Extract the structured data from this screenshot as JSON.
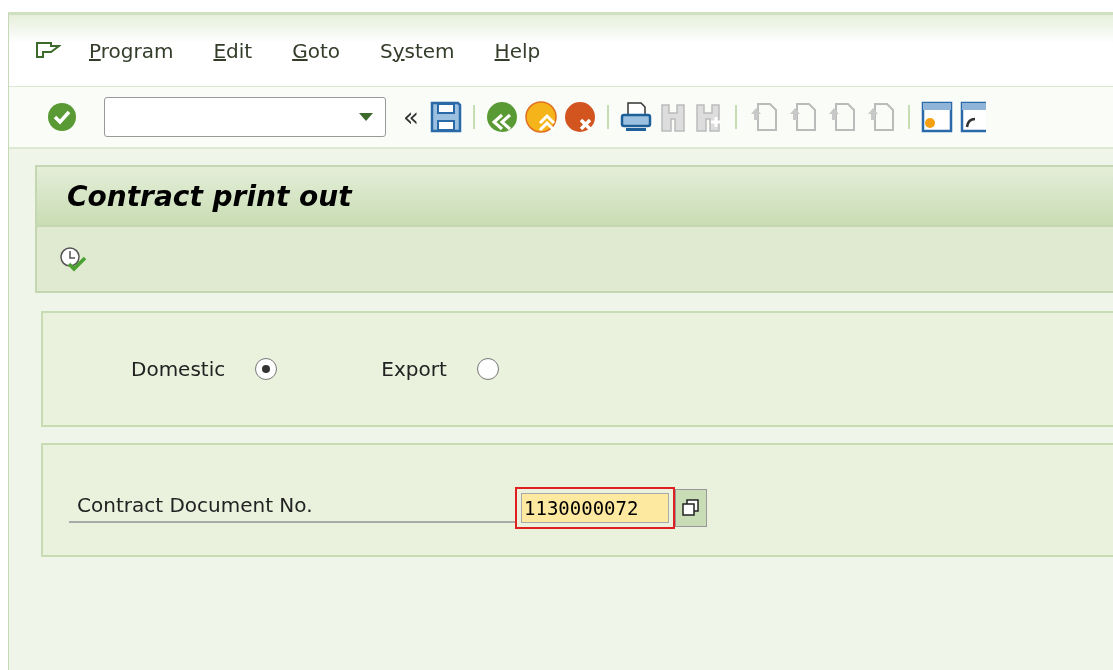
{
  "menu": [
    {
      "key": "P",
      "rest": "rogram"
    },
    {
      "key": "E",
      "rest": "dit"
    },
    {
      "key": "G",
      "rest": "oto"
    },
    {
      "lead": "S",
      "key": "y",
      "rest": "stem"
    },
    {
      "key": "H",
      "rest": "elp"
    }
  ],
  "toolbar": {
    "back_chevrons": "«"
  },
  "title": "Contract print out",
  "radios": [
    {
      "label": "Domestic",
      "selected": true
    },
    {
      "label": "Export",
      "selected": false
    }
  ],
  "field": {
    "label": "Contract Document No.",
    "value": "1130000072",
    "focused": true
  }
}
